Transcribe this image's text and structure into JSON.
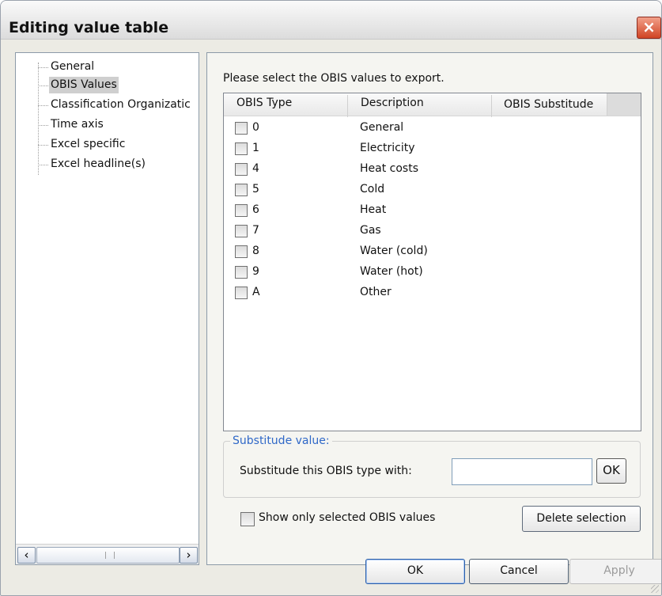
{
  "window": {
    "title": "Editing value table",
    "close_icon": "×"
  },
  "tree": {
    "items": [
      {
        "label": "General",
        "selected": false
      },
      {
        "label": "OBIS Values",
        "selected": true
      },
      {
        "label": "Classification Organizatic",
        "selected": false
      },
      {
        "label": "Time axis",
        "selected": false
      },
      {
        "label": "Excel specific",
        "selected": false
      },
      {
        "label": "Excel headline(s)",
        "selected": false
      }
    ],
    "scroll_left": "‹",
    "scroll_right": "›"
  },
  "panel": {
    "instruction": "Please select the OBIS values to export.",
    "columns": [
      "OBIS Type",
      "Description",
      "OBIS Substitude"
    ],
    "rows": [
      {
        "type": "0",
        "description": "General",
        "checked": false
      },
      {
        "type": "1",
        "description": "Electricity",
        "checked": false
      },
      {
        "type": "4",
        "description": "Heat costs",
        "checked": false
      },
      {
        "type": "5",
        "description": "Cold",
        "checked": false
      },
      {
        "type": "6",
        "description": "Heat",
        "checked": false
      },
      {
        "type": "7",
        "description": "Gas",
        "checked": false
      },
      {
        "type": "8",
        "description": "Water (cold)",
        "checked": false
      },
      {
        "type": "9",
        "description": "Water (hot)",
        "checked": false
      },
      {
        "type": "A",
        "description": "Other",
        "checked": false
      }
    ],
    "substitute_group": {
      "title": "Substitude value:",
      "label": "Substitude this OBIS type with:",
      "input_value": "",
      "ok_label": "OK"
    },
    "show_selected_label": "Show only selected OBIS values",
    "delete_selection_label": "Delete selection"
  },
  "footer": {
    "ok_label": "OK",
    "cancel_label": "Cancel",
    "apply_label": "Apply"
  },
  "colors": {
    "group_title": "#2f68c8",
    "close_button": "#d04424",
    "selection": "#cfcfcf"
  }
}
